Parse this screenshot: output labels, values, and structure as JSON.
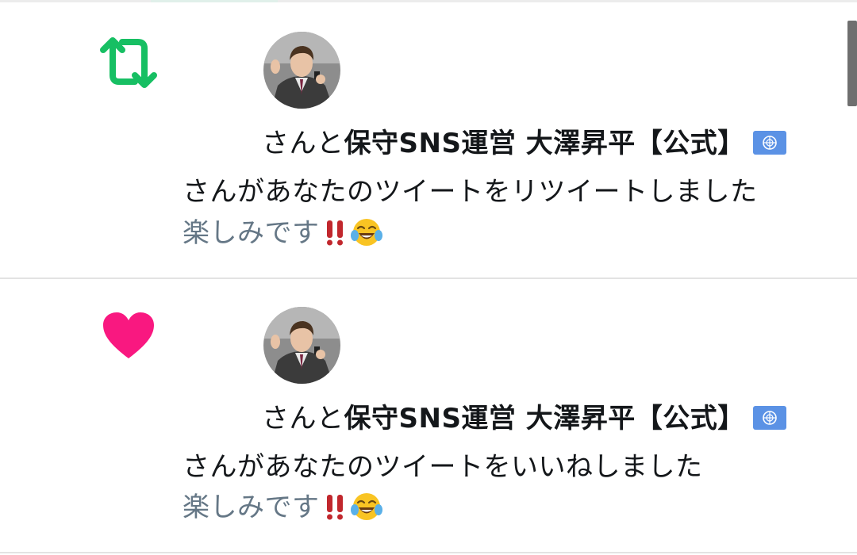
{
  "notifications": [
    {
      "type": "retweet",
      "type_icon": "retweet-icon",
      "type_color": "#17bf63",
      "avatar": "user-avatar",
      "name_suffix": "さんと",
      "display_name": "保守SNS運営 大澤昇平【公式】",
      "badge": "un-flag-badge",
      "action_text": "さんがあなたのツイートをリツイートしました",
      "tweet_snippet": "楽しみです",
      "snippet_emoji": [
        "double-exclamation-icon",
        "tears-of-joy-icon"
      ]
    },
    {
      "type": "like",
      "type_icon": "heart-icon",
      "type_color": "#f91880",
      "avatar": "user-avatar",
      "name_suffix": "さんと",
      "display_name": "保守SNS運営 大澤昇平【公式】",
      "badge": "un-flag-badge",
      "action_text": "さんがあなたのツイートをいいねしました",
      "tweet_snippet": "楽しみです",
      "snippet_emoji": [
        "double-exclamation-icon",
        "tears-of-joy-icon"
      ]
    }
  ],
  "colors": {
    "text": "#14171a",
    "secondary_text": "#657786",
    "divider": "#e3e3e3",
    "badge_blue": "#5b92e5",
    "exclamation_red": "#c1272d"
  }
}
